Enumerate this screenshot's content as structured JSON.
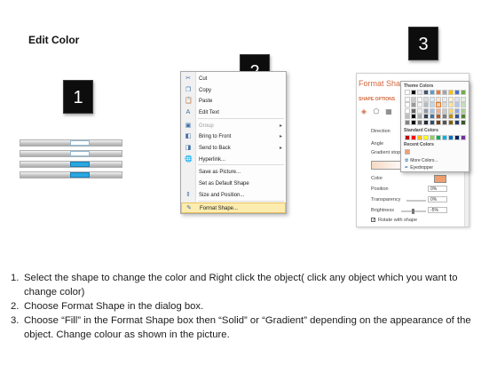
{
  "title": "Edit Color",
  "badges": [
    "1",
    "2",
    "3"
  ],
  "context_menu": {
    "items": [
      {
        "label": "Cut",
        "icon": "scissors-icon",
        "glyph": "✂",
        "disabled": false,
        "submenu": false
      },
      {
        "label": "Copy",
        "icon": "copy-icon",
        "glyph": "❐",
        "disabled": false,
        "submenu": false
      },
      {
        "label": "Paste",
        "icon": "paste-icon",
        "glyph": "📋",
        "disabled": false,
        "submenu": false
      },
      {
        "label": "Edit Text",
        "icon": "edit-text-icon",
        "glyph": "A",
        "disabled": false,
        "submenu": false
      },
      {
        "label": "Group",
        "icon": "group-icon",
        "glyph": "▣",
        "disabled": true,
        "submenu": true
      },
      {
        "label": "Bring to Front",
        "icon": "bring-front-icon",
        "glyph": "◧",
        "disabled": false,
        "submenu": true
      },
      {
        "label": "Send to Back",
        "icon": "send-back-icon",
        "glyph": "◨",
        "disabled": false,
        "submenu": true
      },
      {
        "label": "Hyperlink...",
        "icon": "hyperlink-icon",
        "glyph": "🌐",
        "disabled": false,
        "submenu": false
      },
      {
        "label": "Save as Picture...",
        "icon": "",
        "glyph": "",
        "disabled": false,
        "submenu": false
      },
      {
        "label": "Set as Default Shape",
        "icon": "",
        "glyph": "",
        "disabled": false,
        "submenu": false
      },
      {
        "label": "Size and Position...",
        "icon": "size-position-icon",
        "glyph": "⇕",
        "disabled": false,
        "submenu": false
      },
      {
        "label": "Format Shape...",
        "icon": "format-shape-icon",
        "glyph": "✎",
        "disabled": false,
        "submenu": false,
        "highlighted": true
      }
    ]
  },
  "format_pane": {
    "title": "Format Shape",
    "shape_options": "SHAPE OPTIONS",
    "direction_label": "Direction",
    "angle_label": "Angle",
    "gradient_stops_label": "Gradient stops",
    "color_label": "Color",
    "position_label": "Position",
    "position_value": "0%",
    "transparency_label": "Transparency",
    "transparency_value": "0%",
    "brightness_label": "Brightness",
    "brightness_value": "-5%",
    "rotate_label": "Rotate with shape"
  },
  "color_picker": {
    "theme_label": "Theme Colors",
    "standard_label": "Standard Colors",
    "recent_label": "Recent Colors",
    "more_colors": "More Colors...",
    "eyedropper": "Eyedropper",
    "theme_columns": [
      "#ffffff",
      "#000000",
      "#e7e6e6",
      "#44546a",
      "#5b9bd5",
      "#ed7d31",
      "#a5a5a5",
      "#ffc000",
      "#4472c4",
      "#70ad47"
    ],
    "standard_colors": [
      "#c00000",
      "#ff0000",
      "#ffc000",
      "#ffff00",
      "#92d050",
      "#00b050",
      "#00b0f0",
      "#0070c0",
      "#002060",
      "#7030a0"
    ],
    "recent_color": "#f0a070"
  },
  "steps": [
    {
      "num": "1.",
      "text": "Select the shape to change the color and Right click the object( click any object which you want to change color)"
    },
    {
      "num": "2.",
      "text": "Choose Format Shape in the dialog box."
    },
    {
      "num": "3.",
      "text": "Choose “Fill” in the Format Shape box then “Solid” or “Gradient” depending on the appearance of the object. Change colour as shown in the picture."
    }
  ]
}
